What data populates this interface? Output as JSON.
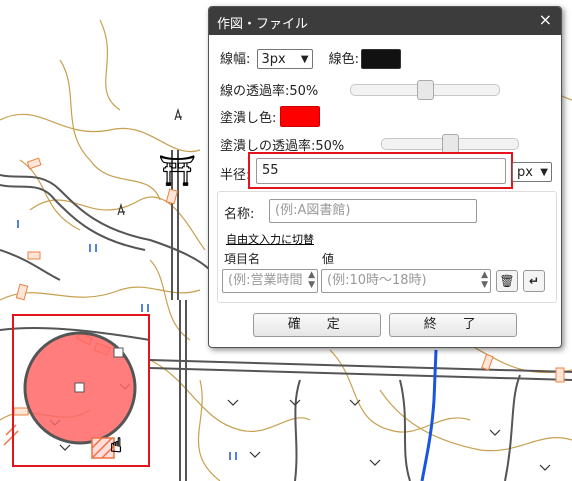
{
  "dialog": {
    "title": "作図・ファイル",
    "close_glyph": "×",
    "line_width_label": "線幅:",
    "line_width_value": "3px",
    "line_color_label": "線色:",
    "line_color": "#111111",
    "line_opacity_label": "線の透過率:50%",
    "line_opacity": 0.5,
    "fill_color_label": "塗潰し色:",
    "fill_color": "#ff0000",
    "fill_opacity_label": "塗潰しの透過率:50%",
    "fill_opacity": 0.5,
    "radius_label": "半径:",
    "radius_value": "55",
    "radius_unit": "px",
    "name_label": "名称:",
    "name_placeholder": "(例:A図書館)",
    "free_input_link": "自由文入力に切替",
    "item_name_header": "項目名",
    "value_header": "値",
    "item_placeholder": "(例:営業時間",
    "value_placeholder": "(例:10時～18時)",
    "confirm_label": "確　定",
    "end_label": "終　了"
  },
  "map": {
    "shrine_symbol": "⛩",
    "highlight_color": "#e3141c",
    "circle_fill": "#ff6666",
    "circle_stroke": "#555555"
  }
}
